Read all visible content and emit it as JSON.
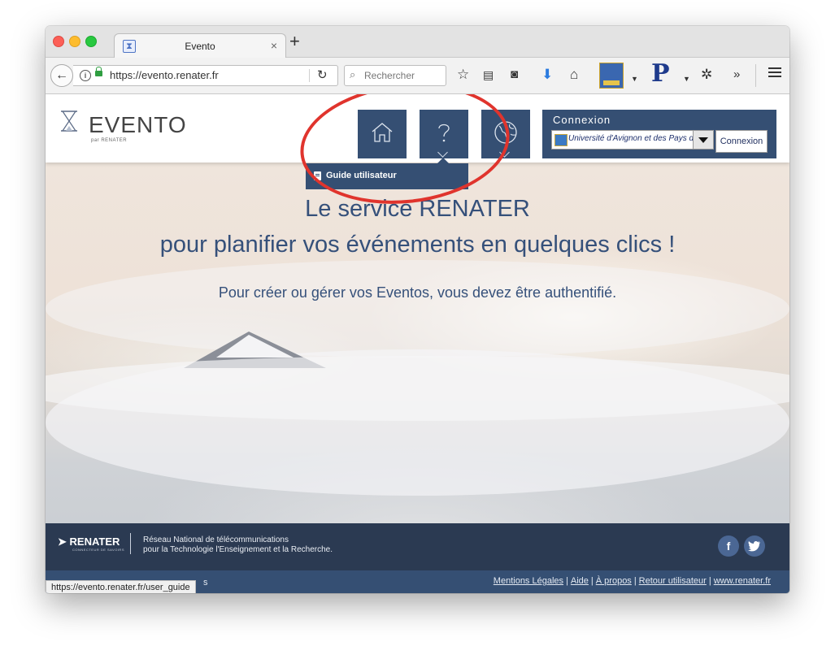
{
  "browser": {
    "tab_title": "Evento",
    "tab_favicon": "hourglass-icon",
    "url": "https://evento.renater.fr",
    "search_placeholder": "Rechercher",
    "status_url": "https://evento.renater.fr/user_guide",
    "status_suffix": "s",
    "toolbar_icons": [
      "star-icon",
      "reading-list-icon",
      "pocket-icon",
      "download-icon",
      "home-icon",
      "extension-icon",
      "p-extension-icon",
      "snippet-icon",
      "overflow-icon",
      "hamburger-menu-icon"
    ]
  },
  "site": {
    "logo_text": "EVENTO",
    "logo_subtitle": "par RENATER",
    "nav_icons": [
      "home-icon",
      "help-icon",
      "language-globe-icon"
    ],
    "connexion": {
      "title": "Connexion",
      "selected_institution": "Université d'Avignon et des Pays de Vaucluse",
      "button_label": "Connexion"
    },
    "help_dropdown": {
      "item_label": "Guide utilisateur"
    },
    "hero": {
      "title_line1": "Le service RENATER",
      "title_line2": "pour planifier vos événements en quelques clics !",
      "subtitle": "Pour créer ou gérer vos Eventos, vous devez être authentifié."
    },
    "footer": {
      "logo": "RENATER",
      "logo_tagline": "CONNECTEUR DE SAVOIRS",
      "description_line1": "Réseau National de télécommunications",
      "description_line2": "pour la Technologie l'Enseignement et la Recherche.",
      "social": [
        "facebook-icon",
        "twitter-icon"
      ],
      "facebook_glyph": "f",
      "links": [
        "Mentions Légales",
        "Aide",
        "À propos",
        "Retour utilisateur",
        "www.renater.fr"
      ]
    }
  },
  "colors": {
    "header_blue": "#354f73",
    "hero_text": "#35507a",
    "annotation_red": "#e0342d"
  }
}
